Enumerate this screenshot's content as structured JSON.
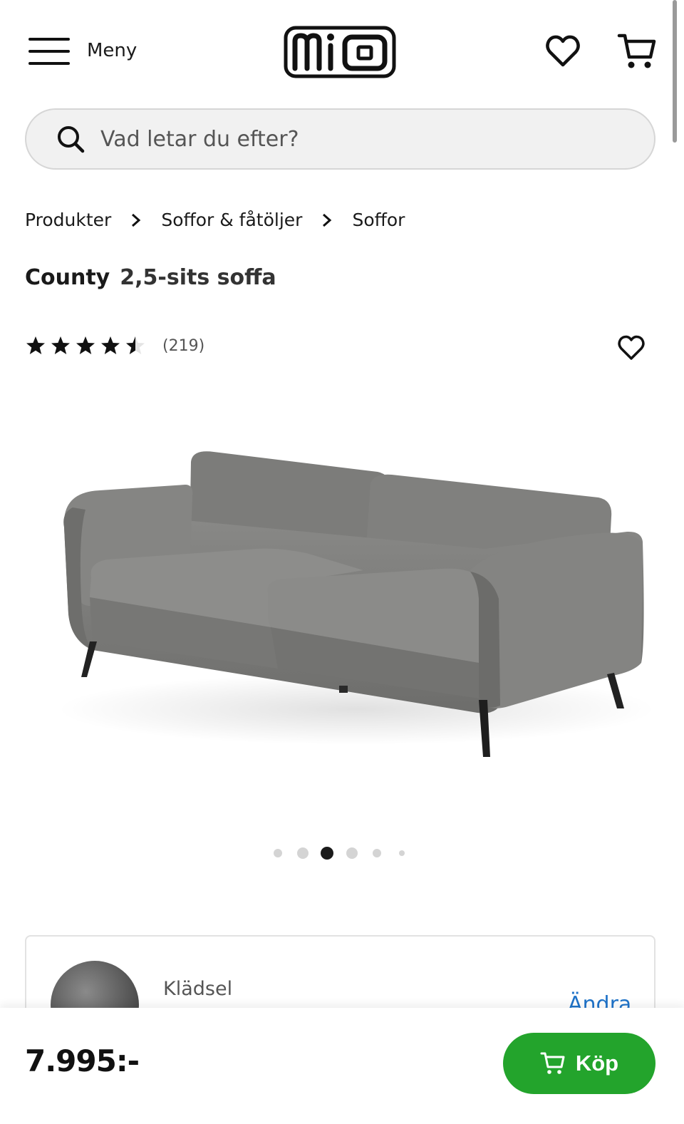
{
  "header": {
    "menu_label": "Meny",
    "logo_text": "mio"
  },
  "search": {
    "placeholder": "Vad letar du efter?"
  },
  "breadcrumb": [
    "Produkter",
    "Soffor & fåtöljer",
    "Soffor"
  ],
  "product": {
    "name": "County",
    "subtitle": "2,5-sits soffa",
    "rating_stars": 4.5,
    "rating_max": 5,
    "review_count": "(219)",
    "image_alt": "",
    "gallery_active_index": 2,
    "gallery_count": 6
  },
  "option": {
    "label": "Klädsel",
    "change_label": "Ändra"
  },
  "purchase": {
    "price": "7.995:-",
    "buy_label": "Köp"
  },
  "colors": {
    "brand_green": "#23a42c",
    "link_blue": "#1f73c9",
    "sofa_grey": "#7b7b79"
  }
}
